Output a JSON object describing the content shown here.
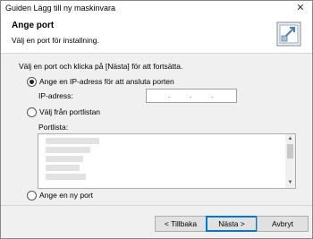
{
  "window": {
    "title": "Guiden Lägg till ny maskinvara",
    "close_symbol": "✕"
  },
  "header": {
    "title": "Ange port",
    "subtitle": "Välj en port för installning."
  },
  "instruction": "Välj en port och klicka på [Nästa] för att fortsätta.",
  "options": {
    "ip": {
      "label": "Ange en IP-adress för att ansluta porten",
      "selected": true
    },
    "ip_field": {
      "label": "IP-adress:",
      "dot": "."
    },
    "portlist": {
      "label": "Välj från portlistan",
      "selected": false
    },
    "portlist_box_label": "Portlista:",
    "new_port": {
      "label": "Ange en ny port",
      "selected": false
    }
  },
  "buttons": {
    "back": "< Tillbaka",
    "next": "Nästa >",
    "cancel": "Avbryt"
  },
  "icons": {
    "scroll_up": "▲",
    "scroll_down": "▼"
  }
}
